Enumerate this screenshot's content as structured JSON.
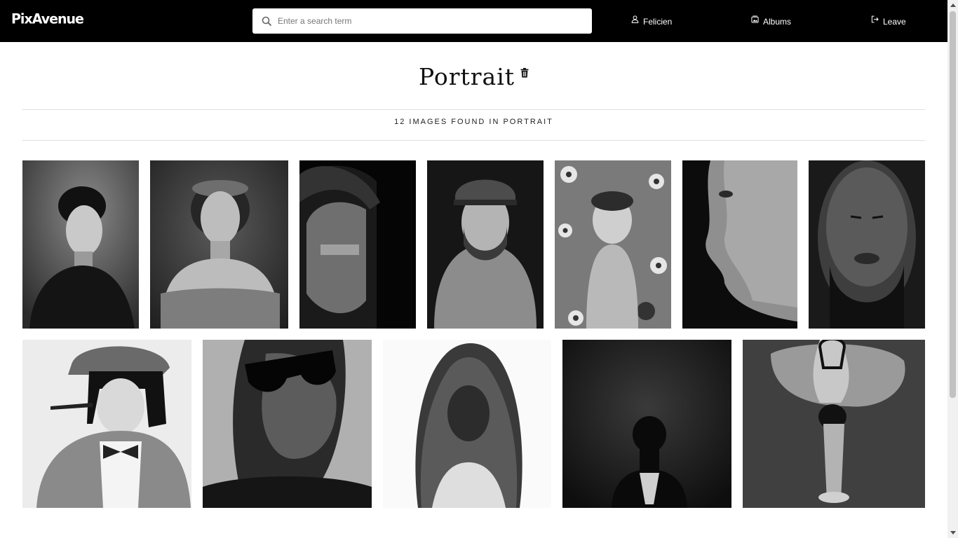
{
  "header": {
    "logo": "PixAvenue",
    "search": {
      "placeholder": "Enter a search term",
      "value": ""
    },
    "nav": [
      {
        "label": "Felicien",
        "icon": "user-icon"
      },
      {
        "label": "Albums",
        "icon": "albums-icon"
      },
      {
        "label": "Leave",
        "icon": "logout-icon"
      }
    ]
  },
  "album": {
    "title": "Portrait",
    "delete_icon": "trash-icon",
    "count_text": "12 IMAGES FOUND IN PORTRAIT"
  },
  "photos": [
    {
      "name": "photo-woman-dark-turtleneck",
      "tone": "dark"
    },
    {
      "name": "photo-woman-floral-crown",
      "tone": "mid-dark"
    },
    {
      "name": "photo-boy-shadowed-face",
      "tone": "dark"
    },
    {
      "name": "photo-bearded-man-cap-hoodie",
      "tone": "dark"
    },
    {
      "name": "photo-woman-in-flowers",
      "tone": "mid"
    },
    {
      "name": "photo-woman-profile",
      "tone": "dark"
    },
    {
      "name": "photo-man-water-drops",
      "tone": "dark"
    },
    {
      "name": "photo-woman-pipe-tweed-cap",
      "tone": "light"
    },
    {
      "name": "photo-man-sunglasses",
      "tone": "mid"
    },
    {
      "name": "photo-woman-fur-hood",
      "tone": "light"
    },
    {
      "name": "photo-woman-bare-back",
      "tone": "dark"
    },
    {
      "name": "photo-ballerina-bowing",
      "tone": "mid-dark"
    }
  ],
  "colors": {
    "topbar": "#000000",
    "background": "#ffffff",
    "divider": "#e0e0e0"
  }
}
